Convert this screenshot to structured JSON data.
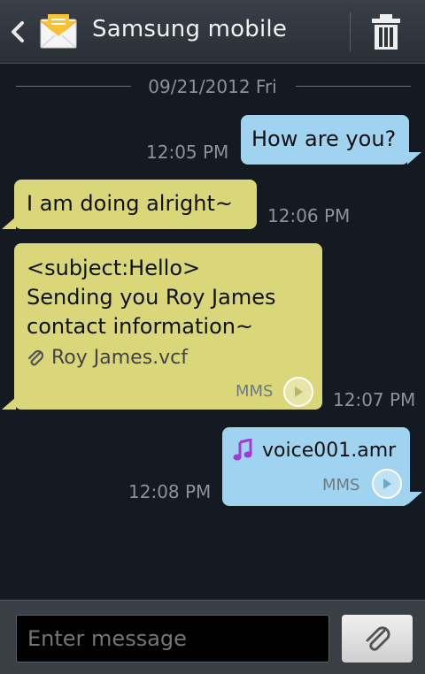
{
  "header": {
    "title": "Samsung mobile",
    "back_icon": "chevron-left-icon",
    "app_icon": "messages-envelope-icon",
    "delete_icon": "trash-icon"
  },
  "date_separator": "09/21/2012 Fri",
  "messages": [
    {
      "direction": "sent",
      "text": "How are you?",
      "time": "12:05 PM"
    },
    {
      "direction": "received",
      "text": "I am doing alright~",
      "time": "12:06 PM"
    },
    {
      "direction": "received",
      "lines": [
        "<subject:Hello>",
        "Sending you Roy James",
        "contact information~"
      ],
      "attachment": "Roy James.vcf",
      "type_label": "MMS",
      "time": "12:07 PM"
    },
    {
      "direction": "sent",
      "attachment": "voice001.amr",
      "type_label": "MMS",
      "time": "12:08 PM"
    }
  ],
  "composer": {
    "placeholder": "Enter message",
    "attach_icon": "paperclip-icon"
  },
  "colors": {
    "sent_bubble": "#9fd3f0",
    "received_bubble": "#d9d77a",
    "background": "#141a22"
  }
}
